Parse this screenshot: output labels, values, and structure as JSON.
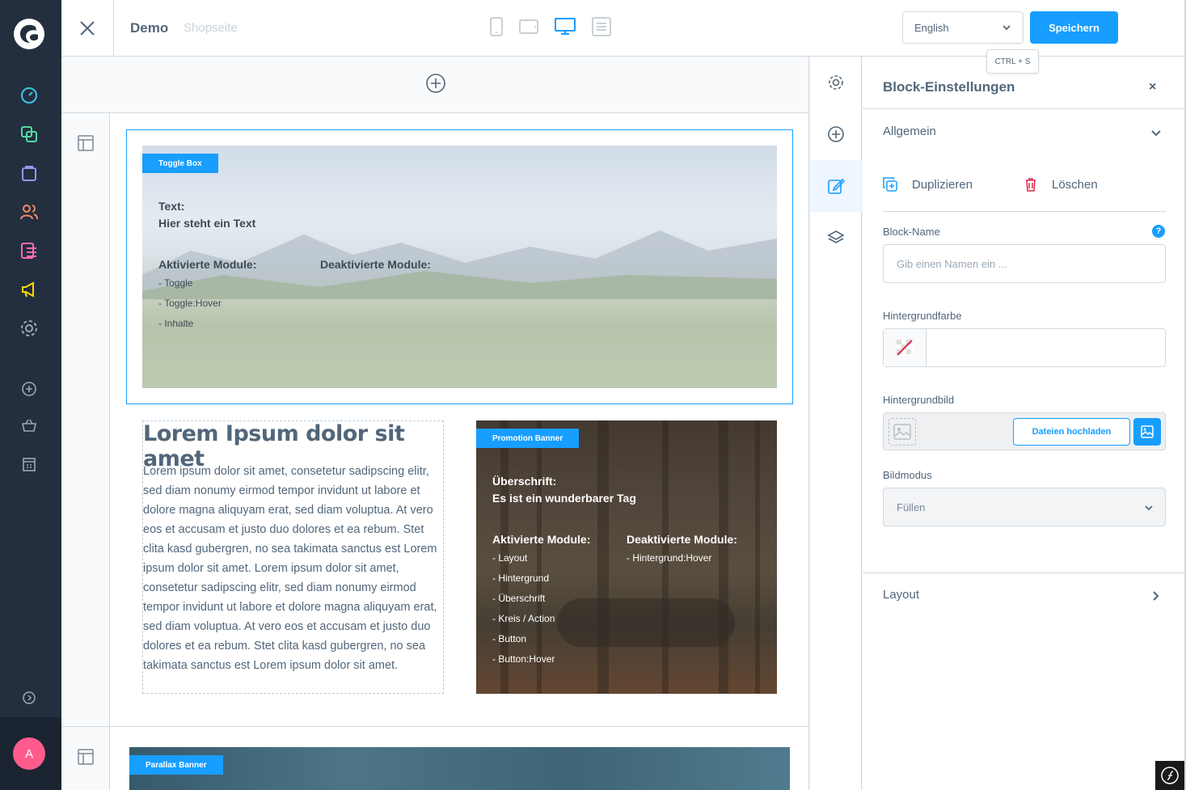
{
  "topbar": {
    "layout_name": "Demo",
    "layout_type": "Shopseite",
    "language": "English",
    "save_label": "Speichern",
    "save_tooltip": "CTRL + S"
  },
  "user": {
    "avatar_initial": "A"
  },
  "canvas": {
    "toggle_box": {
      "badge": "Toggle Box",
      "text_label": "Text:",
      "text_value": "Hier steht ein Text",
      "active_heading": "Aktivierte Module:",
      "inactive_heading": "Deaktivierte Module:",
      "active_items": [
        "- Toggle",
        "- Toggle:Hover",
        "- Inhalte"
      ]
    },
    "lorem": {
      "title": "Lorem Ipsum dolor sit amet",
      "body": "Lorem ipsum dolor sit amet, consetetur sadipscing elitr, sed diam nonumy eirmod tempor invidunt ut labore et dolore magna aliquyam erat, sed diam voluptua. At vero eos et accusam et justo duo dolores et ea rebum. Stet clita kasd gubergren, no sea takimata sanctus est Lorem ipsum dolor sit amet. Lorem ipsum dolor sit amet, consetetur sadipscing elitr, sed diam nonumy eirmod tempor invidunt ut labore et dolore magna aliquyam erat, sed diam voluptua. At vero eos et accusam et justo duo dolores et ea rebum. Stet clita kasd gubergren, no sea takimata sanctus est Lorem ipsum dolor sit amet."
    },
    "promotion": {
      "badge": "Promotion Banner",
      "heading_label": "Überschrift:",
      "heading_value": "Es ist ein wunderbarer Tag",
      "active_heading": "Aktivierte Module:",
      "inactive_heading": "Deaktivierte Module:",
      "active_items": [
        "- Layout",
        "- Hintergrund",
        "- Überschrift",
        "- Kreis / Action",
        "- Button",
        "- Button:Hover"
      ],
      "inactive_items": [
        "- Hintergrund:Hover"
      ]
    },
    "parallax": {
      "badge": "Parallax Banner"
    }
  },
  "panel": {
    "title": "Block-Einstellungen",
    "close": "×",
    "section_general": "Allgemein",
    "duplicate_label": "Duplizieren",
    "delete_label": "Löschen",
    "block_name_label": "Block-Name",
    "block_name_placeholder": "Gib einen Namen ein ...",
    "help": "?",
    "bg_color_label": "Hintergrundfarbe",
    "bg_image_label": "Hintergrundbild",
    "upload_label": "Dateien hochladen",
    "image_mode_label": "Bildmodus",
    "image_mode_value": "Füllen",
    "section_layout": "Layout"
  },
  "colors": {
    "accent": "#189eff",
    "sidebar": "#232f3f",
    "avatar": "#ff5b8d"
  }
}
